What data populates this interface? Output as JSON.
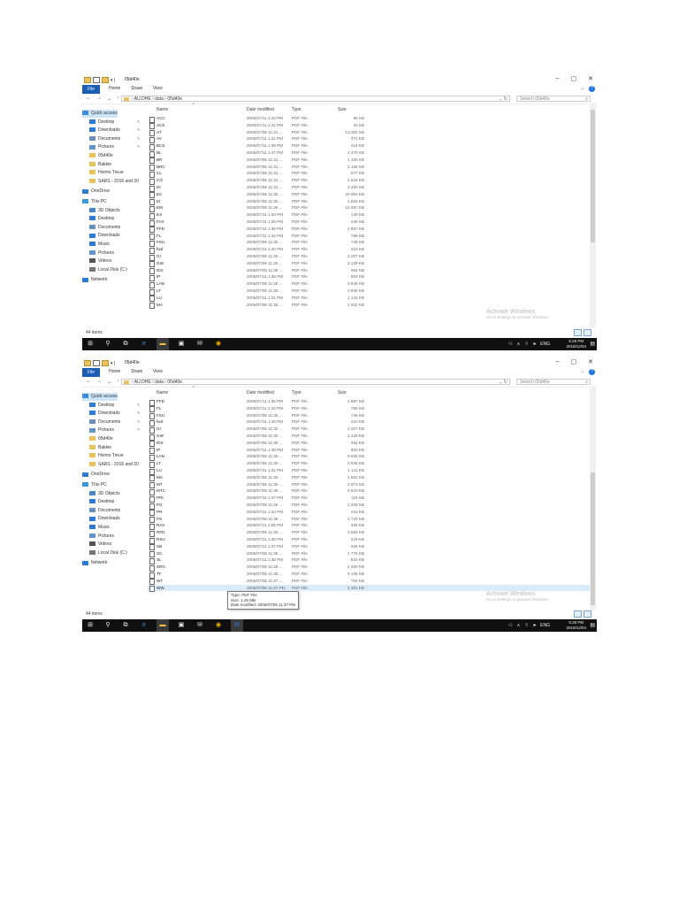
{
  "window": {
    "title": "05d40e",
    "minimize_icon": "minimize-icon",
    "maximize_icon": "maximize-icon",
    "close_icon": "close-icon"
  },
  "ribbon": {
    "file": "File",
    "home": "Home",
    "share": "Share",
    "view": "View",
    "help": "?"
  },
  "address": {
    "path": [
      "AU.DHE",
      "data",
      "05d40e"
    ],
    "search_placeholder": "Search 05d40e"
  },
  "nav": {
    "quick_access": "Quick access",
    "quick_items": [
      "Desktop",
      "Downloads",
      "Documents",
      "Pictures",
      "05d40e",
      "Bakkie",
      "Heimo Treue",
      "SARS - 2016 and 20"
    ],
    "onedrive": "OneDrive",
    "this_pc": "This PC",
    "pc_items": [
      "3D Objects",
      "Desktop",
      "Documents",
      "Downloads",
      "Music",
      "Pictures",
      "Videos",
      "Local Disk (C:)"
    ],
    "network": "Network"
  },
  "columns": {
    "name": "Name",
    "date": "Date modified",
    "type": "Type",
    "size": "Size"
  },
  "files1": [
    {
      "name": "ACC",
      "date": "2005/07/11 1:33 PM",
      "type": "PDF File",
      "size": "98 KB"
    },
    {
      "name": "ACS",
      "date": "2005/07/11 1:41 PM",
      "type": "PDF File",
      "size": "20 KB"
    },
    {
      "name": "AT",
      "date": "2005/07/06 11:31 ...",
      "type": "PDF File",
      "size": "13 302 KB"
    },
    {
      "name": "AV",
      "date": "2005/07/11 1:41 PM",
      "type": "PDF File",
      "size": "371 KB"
    },
    {
      "name": "BCS",
      "date": "2005/07/11 1:39 PM",
      "type": "PDF File",
      "size": "414 KB"
    },
    {
      "name": "BL",
      "date": "2005/07/11 1:47 PM",
      "type": "PDF File",
      "size": "4 370 KB"
    },
    {
      "name": "BR",
      "date": "2005/07/06 11:31 ...",
      "type": "PDF File",
      "size": "1 100 KB"
    },
    {
      "name": "BRC",
      "date": "2005/07/06 11:31 ...",
      "type": "PDF File",
      "size": "1 128 KB"
    },
    {
      "name": "CL",
      "date": "2005/07/06 11:31 ...",
      "type": "PDF File",
      "size": "877 KB"
    },
    {
      "name": "CO",
      "date": "2005/07/06 11:31 ...",
      "type": "PDF File",
      "size": "1 644 KB"
    },
    {
      "name": "DI",
      "date": "2005/07/06 11:31 ...",
      "type": "PDF File",
      "size": "2 400 KB"
    },
    {
      "name": "EC",
      "date": "2005/07/06 11:35 ...",
      "type": "PDF File",
      "size": "20 052 KB"
    },
    {
      "name": "EI",
      "date": "2005/07/06 11:35 ...",
      "type": "PDF File",
      "size": "1 504 KB"
    },
    {
      "name": "EM",
      "date": "2005/07/06 11:35 ...",
      "type": "PDF File",
      "size": "12 067 KB"
    },
    {
      "name": "EX",
      "date": "2005/07/11 1:33 PM",
      "type": "PDF File",
      "size": "140 KB"
    },
    {
      "name": "FAX",
      "date": "2005/07/11 1:25 PM",
      "type": "PDF File",
      "size": "445 KB"
    },
    {
      "name": "FFD",
      "date": "2005/07/11 1:35 PM",
      "type": "PDF File",
      "size": "1 867 KB"
    },
    {
      "name": "FL",
      "date": "2005/07/11 1:42 PM",
      "type": "PDF File",
      "size": "755 KB"
    },
    {
      "name": "FSU",
      "date": "2005/07/06 11:35 ...",
      "type": "PDF File",
      "size": "746 KB"
    },
    {
      "name": "fwd",
      "date": "2005/07/11 1:40 PM",
      "type": "PDF File",
      "size": "410 KB"
    },
    {
      "name": "GI",
      "date": "2005/07/06 11:35 ...",
      "type": "PDF File",
      "size": "2 207 KB"
    },
    {
      "name": "GW",
      "date": "2005/07/06 11:35 ...",
      "type": "PDF File",
      "size": "2 129 KB"
    },
    {
      "name": "IDX",
      "date": "2005/07/06 11:38 ...",
      "type": "PDF File",
      "size": "454 KB"
    },
    {
      "name": "IP",
      "date": "2005/07/11 1:38 PM",
      "type": "PDF File",
      "size": "803 KB"
    },
    {
      "name": "LAN",
      "date": "2005/07/06 11:36 ...",
      "type": "PDF File",
      "size": "5 825 KB"
    },
    {
      "name": "LT",
      "date": "2005/07/06 11:36 ...",
      "type": "PDF File",
      "size": "3 626 KB"
    },
    {
      "name": "LU",
      "date": "2005/07/11 1:31 PM",
      "type": "PDF File",
      "size": "1 141 KB"
    },
    {
      "name": "MA",
      "date": "2005/07/06 11:36 ...",
      "type": "PDF File",
      "size": "1 922 KB"
    }
  ],
  "files2": [
    {
      "name": "FFD",
      "date": "2005/07/11 1:35 PM",
      "type": "PDF File",
      "size": "1 867 KB"
    },
    {
      "name": "FL",
      "date": "2005/07/11 1:42 PM",
      "type": "PDF File",
      "size": "755 KB"
    },
    {
      "name": "FSU",
      "date": "2005/07/06 11:35 ...",
      "type": "PDF File",
      "size": "746 KB"
    },
    {
      "name": "fwd",
      "date": "2005/07/11 1:40 PM",
      "type": "PDF File",
      "size": "410 KB"
    },
    {
      "name": "GI",
      "date": "2005/07/06 11:35 ...",
      "type": "PDF File",
      "size": "2 207 KB"
    },
    {
      "name": "GW",
      "date": "2005/07/06 11:35 ...",
      "type": "PDF File",
      "size": "2 129 KB"
    },
    {
      "name": "IDX",
      "date": "2005/07/06 11:38 ...",
      "type": "PDF File",
      "size": "454 KB"
    },
    {
      "name": "IP",
      "date": "2005/07/11 1:38 PM",
      "type": "PDF File",
      "size": "803 KB"
    },
    {
      "name": "LAN",
      "date": "2005/07/06 11:36 ...",
      "type": "PDF File",
      "size": "5 825 KB"
    },
    {
      "name": "LT",
      "date": "2005/07/06 11:36 ...",
      "type": "PDF File",
      "size": "3 626 KB"
    },
    {
      "name": "LU",
      "date": "2005/07/11 1:31 PM",
      "type": "PDF File",
      "size": "1 141 KB"
    },
    {
      "name": "MA",
      "date": "2005/07/06 11:36 ...",
      "type": "PDF File",
      "size": "1 922 KB"
    },
    {
      "name": "MT",
      "date": "2005/07/06 11:36 ...",
      "type": "PDF File",
      "size": "2 973 KB"
    },
    {
      "name": "MTC",
      "date": "2005/07/06 11:36 ...",
      "type": "PDF File",
      "size": "4 610 KB"
    },
    {
      "name": "PRI",
      "date": "2005/07/11 1:47 PM",
      "type": "PDF File",
      "size": "116 KB"
    },
    {
      "name": "PG",
      "date": "2005/07/06 11:28 ...",
      "type": "PDF File",
      "size": "2 205 KB"
    },
    {
      "name": "PR",
      "date": "2005/07/11 1:34 PM",
      "type": "PDF File",
      "size": "441 KB"
    },
    {
      "name": "PS",
      "date": "2005/07/06 11:38 ...",
      "type": "PDF File",
      "size": "1 723 KB"
    },
    {
      "name": "RAX",
      "date": "2005/07/11 1:06 PM",
      "type": "PDF File",
      "size": "334 KB"
    },
    {
      "name": "RFD",
      "date": "2005/07/06 11:36 ...",
      "type": "PDF File",
      "size": "2 593 KB"
    },
    {
      "name": "RSU",
      "date": "2005/07/11 1:36 PM",
      "type": "PDF File",
      "size": "419 KB"
    },
    {
      "name": "SB",
      "date": "2005/07/11 1:37 PM",
      "type": "PDF File",
      "size": "334 KB"
    },
    {
      "name": "SC",
      "date": "2005/07/06 11:36 ...",
      "type": "PDF File",
      "size": "1 775 KB"
    },
    {
      "name": "SL",
      "date": "2005/07/11 1:38 PM",
      "type": "PDF File",
      "size": "832 KB"
    },
    {
      "name": "SRG",
      "date": "2005/07/06 11:38 ...",
      "type": "PDF File",
      "size": "1 200 KB"
    },
    {
      "name": "TF",
      "date": "2005/07/06 11:38 ...",
      "type": "PDF File",
      "size": "5 105 KB"
    },
    {
      "name": "WT",
      "date": "2005/07/06 11:37 ...",
      "type": "PDF File",
      "size": "702 KB"
    },
    {
      "name": "WW",
      "date": "2005/07/06 11:37 PM",
      "type": "PDF File",
      "size": "1 301 KB"
    }
  ],
  "tooltip": {
    "type": "Type: PDF File",
    "size": "Size: 1.26 MB",
    "date": "Date modified: 2005/07/06 11:37 PM"
  },
  "status": "44 items",
  "watermark": {
    "line1": "Activate Windows",
    "line2": "Go to Settings to activate Windows."
  },
  "taskbar": {
    "time": "5:28 PM",
    "date": "2018/12/04",
    "lang": "ENG",
    "icons": [
      "windows-start-icon",
      "search-icon",
      "task-view-icon",
      "edge-icon",
      "file-explorer-icon",
      "store-icon",
      "mail-icon",
      "chrome-icon",
      "word-icon"
    ]
  },
  "colors": {
    "accent": "#1a5fb4",
    "taskbar": "#101010",
    "selection": "#cce4f7"
  }
}
